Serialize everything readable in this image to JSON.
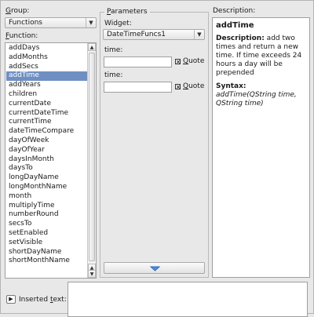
{
  "group": {
    "label": "Group:",
    "selected": "Functions"
  },
  "function": {
    "label": "Function:",
    "items": [
      "addDays",
      "addMonths",
      "addSecs",
      "addTime",
      "addYears",
      "children",
      "currentDate",
      "currentDateTime",
      "currentTime",
      "dateTimeCompare",
      "dayOfWeek",
      "dayOfYear",
      "daysInMonth",
      "daysTo",
      "longDayName",
      "longMonthName",
      "month",
      "multiplyTime",
      "numberRound",
      "secsTo",
      "setEnabled",
      "setVisible",
      "shortDayName",
      "shortMonthName"
    ],
    "selected_index": 3
  },
  "parameters": {
    "title": "Parameters",
    "widget_label": "Widget:",
    "widget_value": "DateTimeFuncs1",
    "params": [
      {
        "label": "time:",
        "quote_label": "Quote"
      },
      {
        "label": "time:",
        "quote_label": "Quote"
      }
    ]
  },
  "description": {
    "label": "Description:",
    "title": "addTime",
    "desc_bold": "Description:",
    "desc_text": " add two times and return a new time. If time exceeds 24 hours a day will be prepended",
    "syntax_bold": "Syntax:",
    "syntax_text": " addTime(QString time, QString time)"
  },
  "inserted": {
    "label": "Inserted text:"
  }
}
